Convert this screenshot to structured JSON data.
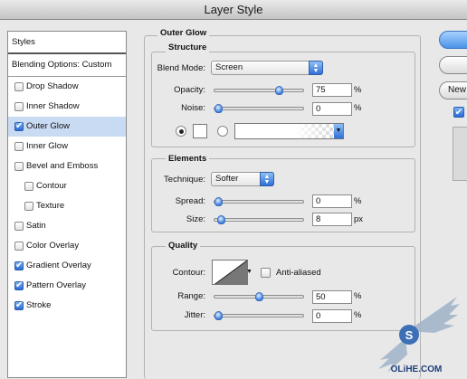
{
  "window": {
    "title": "Layer Style"
  },
  "styles_panel": {
    "header": "Styles",
    "blending": "Blending Options: Custom",
    "items": [
      {
        "label": "Drop Shadow",
        "checked": false
      },
      {
        "label": "Inner Shadow",
        "checked": false
      },
      {
        "label": "Outer Glow",
        "checked": true
      },
      {
        "label": "Inner Glow",
        "checked": false
      },
      {
        "label": "Bevel and Emboss",
        "checked": false
      },
      {
        "label": "Contour",
        "checked": false
      },
      {
        "label": "Texture",
        "checked": false
      },
      {
        "label": "Satin",
        "checked": false
      },
      {
        "label": "Color Overlay",
        "checked": false
      },
      {
        "label": "Gradient Overlay",
        "checked": true
      },
      {
        "label": "Pattern Overlay",
        "checked": true
      },
      {
        "label": "Stroke",
        "checked": true
      }
    ]
  },
  "outer_glow": {
    "title": "Outer Glow",
    "structure": {
      "title": "Structure",
      "blend_mode_label": "Blend Mode:",
      "blend_mode": "Screen",
      "opacity_label": "Opacity:",
      "opacity": "75",
      "opacity_fraction": 0.75,
      "noise_label": "Noise:",
      "noise": "0",
      "noise_fraction": 0,
      "percent": "%"
    },
    "elements": {
      "title": "Elements",
      "technique_label": "Technique:",
      "technique": "Softer",
      "spread_label": "Spread:",
      "spread": "0",
      "spread_fraction": 0,
      "size_label": "Size:",
      "size": "8",
      "size_fraction": 0.03,
      "percent": "%",
      "px": "px"
    },
    "quality": {
      "title": "Quality",
      "contour_label": "Contour:",
      "anti_aliased": "Anti-aliased",
      "range_label": "Range:",
      "range": "50",
      "range_fraction": 0.5,
      "jitter_label": "Jitter:",
      "jitter": "0",
      "jitter_fraction": 0,
      "percent": "%"
    }
  },
  "buttons": {
    "new": "New"
  },
  "watermark": {
    "brand": "OLiHE.COM"
  }
}
